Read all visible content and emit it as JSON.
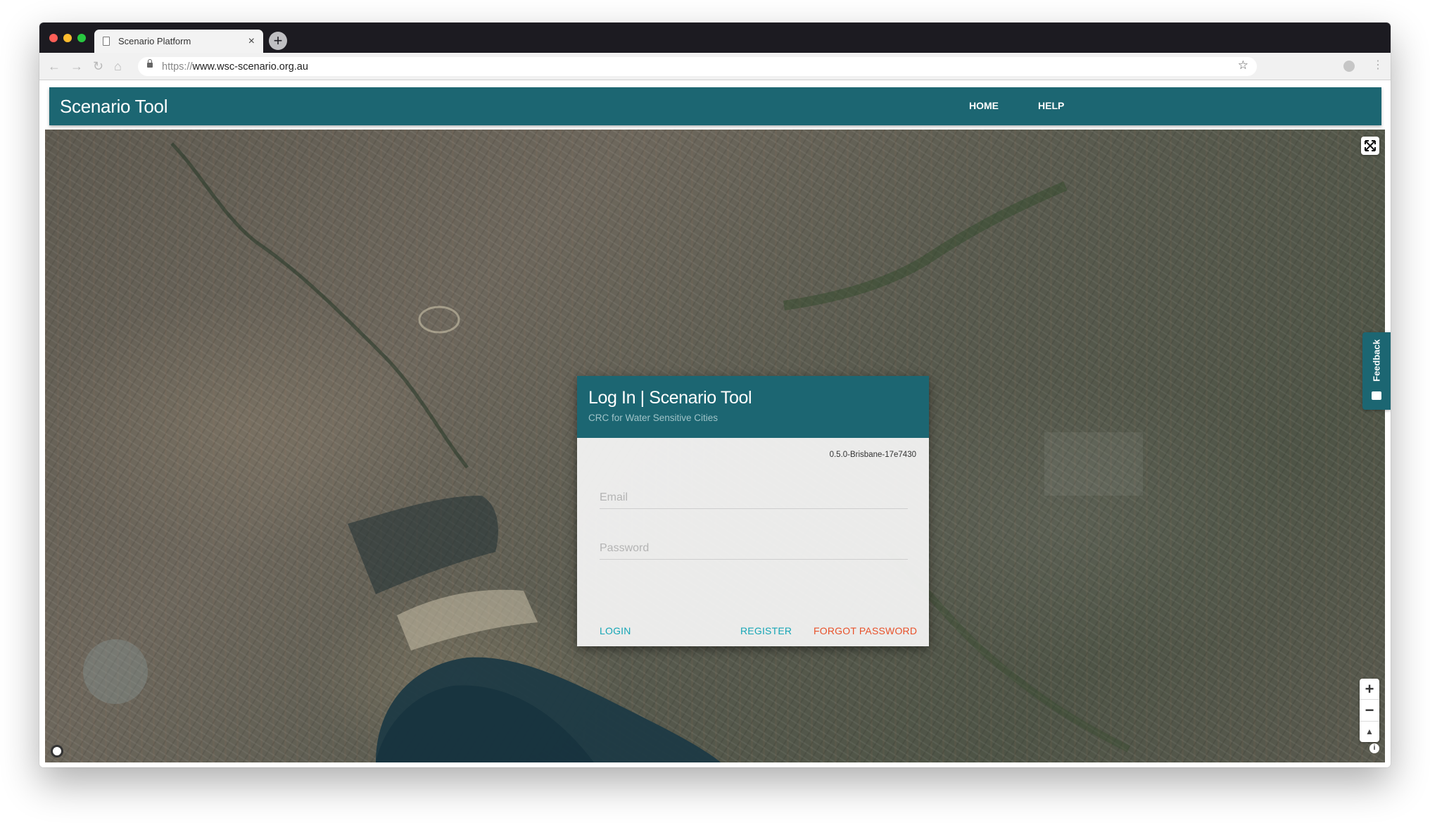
{
  "browser": {
    "tab_title": "Scenario Platform",
    "tab_close": "×",
    "new_tab": "+",
    "url_scheme": "https://",
    "url_host": "www.wsc-scenario.org.au",
    "back": "←",
    "forward": "→",
    "reload": "↻",
    "home": "⌂",
    "bookmark": "☆",
    "menu": "⋮",
    "traffic_colors": [
      "#fe5f57",
      "#febc2e",
      "#28c840"
    ]
  },
  "header": {
    "brand": "Scenario Tool",
    "nav": [
      "HOME",
      "HELP"
    ],
    "color": "#1c6672"
  },
  "map": {
    "fullscreen_icon": "⤢",
    "zoom_in": "+",
    "zoom_out": "−",
    "compass": "▲",
    "info": "i"
  },
  "feedback": {
    "label": "Feedback"
  },
  "login": {
    "title": "Log In | Scenario Tool",
    "subtitle": "CRC for Water Sensitive Cities",
    "version": "0.5.0-Brisbane-17e7430",
    "email_placeholder": "Email",
    "password_placeholder": "Password",
    "login_label": "LOGIN",
    "register_label": "REGISTER",
    "forgot_label": "FORGOT PASSWORD",
    "accent_color": "#16a6b6",
    "danger_color": "#e8522b"
  }
}
